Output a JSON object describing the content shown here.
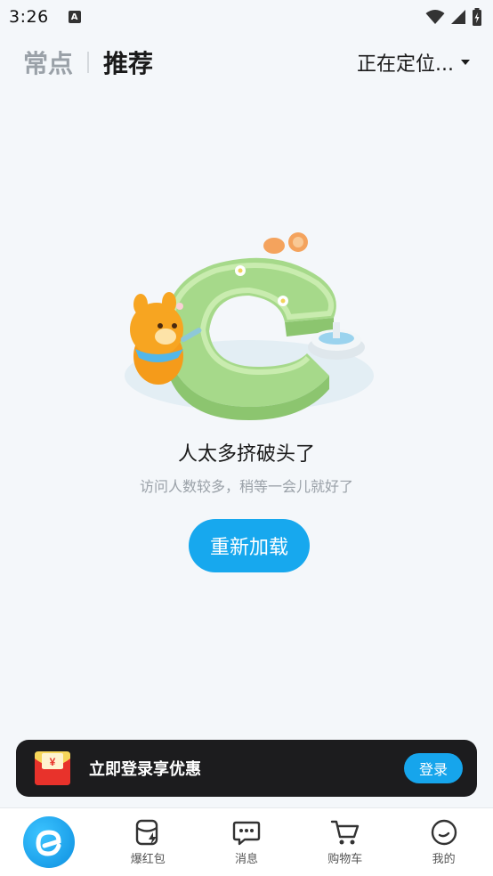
{
  "status_bar": {
    "time": "3:26",
    "notif_letter": "A"
  },
  "header": {
    "tab_frequent": "常点",
    "tab_recommend": "推荐",
    "location": "正在定位..."
  },
  "error": {
    "title": "人太多挤破头了",
    "subtitle": "访问人数较多，稍等一会儿就好了",
    "reload_label": "重新加载"
  },
  "login_banner": {
    "text": "立即登录享优惠",
    "button_label": "登录",
    "coupon_symbol": "¥"
  },
  "bottom_nav": {
    "items": [
      {
        "label": "",
        "icon": "home-logo-icon"
      },
      {
        "label": "爆红包",
        "icon": "red-packet-icon"
      },
      {
        "label": "消息",
        "icon": "message-icon"
      },
      {
        "label": "购物车",
        "icon": "cart-icon"
      },
      {
        "label": "我的",
        "icon": "profile-icon"
      }
    ]
  },
  "colors": {
    "accent": "#17a8ee",
    "background": "#f4f7fa",
    "banner": "#1c1c1e"
  }
}
